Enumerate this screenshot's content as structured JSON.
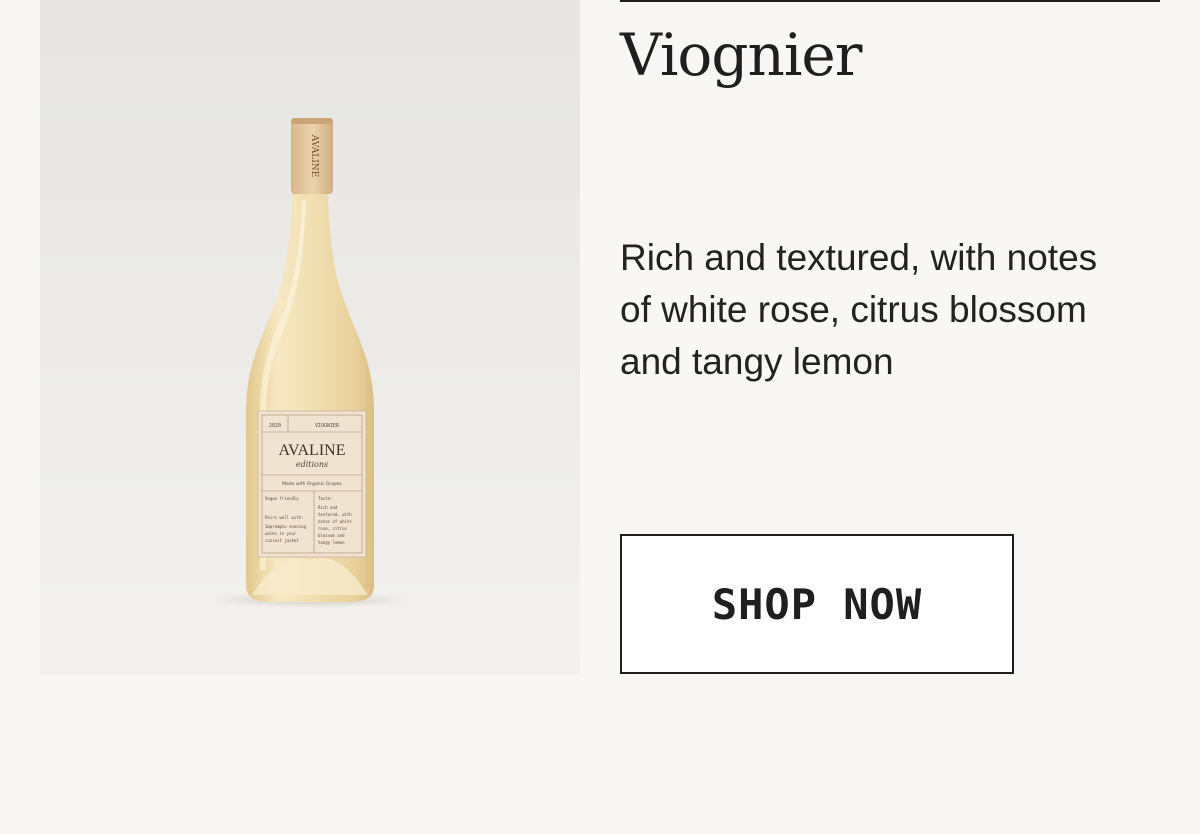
{
  "product": {
    "title": "Viognier",
    "description": "Rich and textured, with notes of white rose, citrus blossom and tangy lemon",
    "cta_label": "SHOP NOW"
  },
  "bottle_label": {
    "year": "2020",
    "varietal": "VIOGNIER",
    "brand": "AVALINE",
    "sub_brand": "editions",
    "tagline": "Made with Organic Grapes",
    "vegan": "Vegan friendly",
    "pairs_heading": "Pairs well with:",
    "pairs_text": [
      "Impromptu evening",
      "walks in your",
      "coziest jacket"
    ],
    "taste_heading": "Taste:",
    "taste_text": [
      "Rich and",
      "textured, with",
      "notes of white",
      "rose, citrus",
      "blossom and",
      "tangy lemon"
    ],
    "cork_text": "AVALINE"
  },
  "colors": {
    "page_background": "#f8f7f5",
    "text": "#1f1f1f",
    "button_background": "#ffffff",
    "wine": "#efdcae",
    "cork": "#e5c9a3",
    "label": "#f1e3d1"
  }
}
